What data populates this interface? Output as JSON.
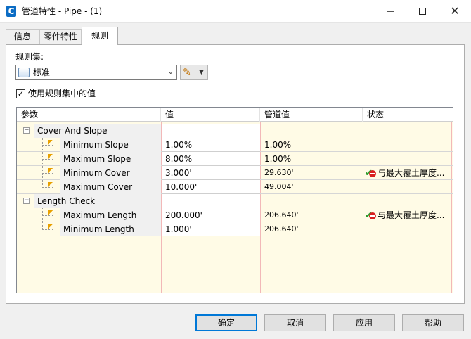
{
  "window": {
    "title": "管道特性 - Pipe - (1)",
    "app_icon": "C",
    "minimize_glyph": "",
    "close_glyph": "✕"
  },
  "tabs": [
    {
      "label": "信息",
      "active": false
    },
    {
      "label": "零件特性",
      "active": false
    },
    {
      "label": "规则",
      "active": true
    }
  ],
  "ruleset": {
    "label": "规则集:",
    "selected": "标准",
    "dropdown_glyph": "⌄"
  },
  "use_ruleset_values": {
    "label": "使用规则集中的值",
    "checked": true,
    "check_glyph": "✓"
  },
  "grid": {
    "columns": [
      "参数",
      "值",
      "管道值",
      "状态"
    ],
    "groups": [
      {
        "name": "Cover And Slope",
        "expanded": true,
        "rows": [
          {
            "param": "Minimum Slope",
            "value": "1.00%",
            "pipe_value": "1.00%",
            "status": ""
          },
          {
            "param": "Maximum Slope",
            "value": "8.00%",
            "pipe_value": "1.00%",
            "status": ""
          },
          {
            "param": "Minimum Cover",
            "value": "3.000'",
            "pipe_value": "29.630'",
            "status": "与最大覆土厚度..."
          },
          {
            "param": "Maximum Cover",
            "value": "10.000'",
            "pipe_value": "49.004'",
            "status": ""
          }
        ]
      },
      {
        "name": "Length Check",
        "expanded": true,
        "rows": [
          {
            "param": "Maximum Length",
            "value": "200.000'",
            "pipe_value": "206.640'",
            "status": "与最大覆土厚度..."
          },
          {
            "param": "Minimum Length",
            "value": "1.000'",
            "pipe_value": "206.640'",
            "status": ""
          }
        ]
      }
    ],
    "expander_glyph": "−"
  },
  "buttons": {
    "ok": "确定",
    "cancel": "取消",
    "apply": "应用",
    "help": "帮助"
  },
  "colors": {
    "grid_background": "#fffbe6",
    "accent": "#0078d7",
    "status_ok": "#2a9a2a",
    "status_violation": "#d81e1e"
  }
}
